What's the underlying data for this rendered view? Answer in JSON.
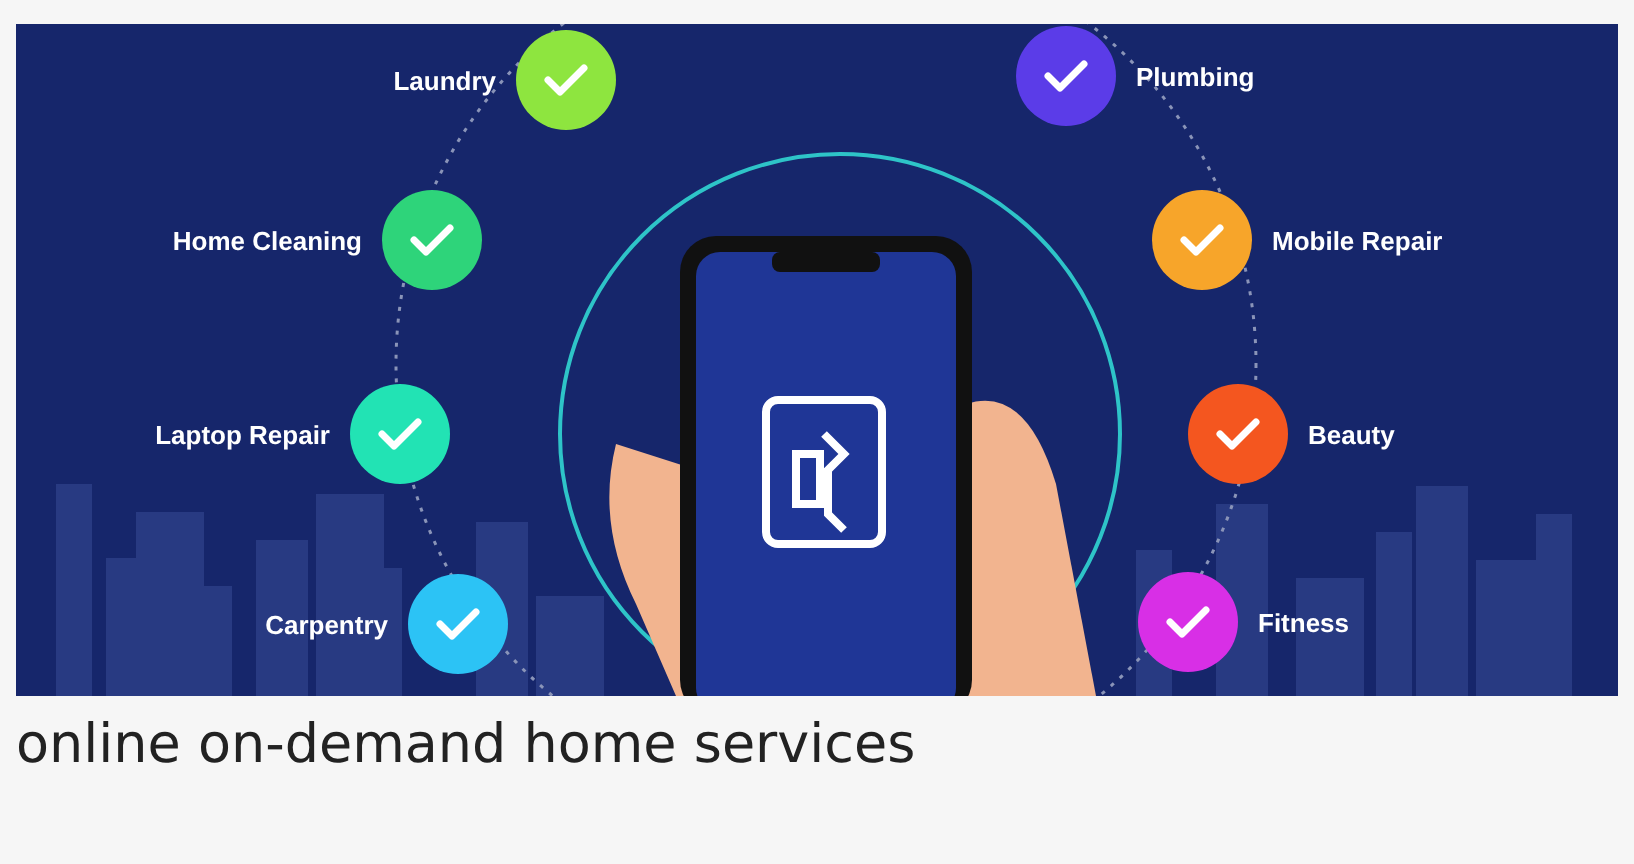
{
  "banner": {
    "left_services": [
      {
        "label": "Laundry",
        "color": "#8ee53f"
      },
      {
        "label": "Home Cleaning",
        "color": "#2ed47a"
      },
      {
        "label": "Laptop Repair",
        "color": "#22e3b4"
      },
      {
        "label": "Carpentry",
        "color": "#2cc3f5"
      }
    ],
    "right_services": [
      {
        "label": "Plumbing",
        "color": "#5b3ce8"
      },
      {
        "label": "Mobile Repair",
        "color": "#f7a52a"
      },
      {
        "label": "Beauty",
        "color": "#f4561f"
      },
      {
        "label": "Fitness",
        "color": "#d82fe6"
      }
    ]
  },
  "caption": "online on-demand home services"
}
